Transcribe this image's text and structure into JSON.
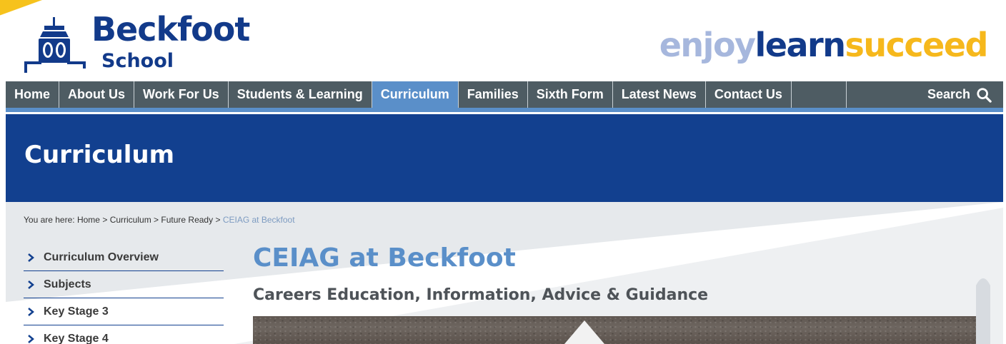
{
  "header": {
    "logo": {
      "name_line1": "Beckfoot",
      "name_line2": "School",
      "icon": "school-crest-icon"
    },
    "tagline": {
      "part1": "enjoy",
      "part2": "learn",
      "part3": "succeed",
      "colors": [
        "#a6b7dd",
        "#123a8a",
        "#f6b81c"
      ]
    }
  },
  "nav": {
    "items": [
      {
        "label": "Home"
      },
      {
        "label": "About Us"
      },
      {
        "label": "Work For Us"
      },
      {
        "label": "Students & Learning"
      },
      {
        "label": "Curriculum",
        "active": true
      },
      {
        "label": "Families"
      },
      {
        "label": "Sixth Form"
      },
      {
        "label": "Latest News"
      },
      {
        "label": "Contact Us"
      }
    ],
    "search_label": "Search",
    "search_icon": "search-icon"
  },
  "banner": {
    "title": "Curriculum"
  },
  "breadcrumb": {
    "prefix": "You are here:",
    "items": [
      "Home",
      "Curriculum",
      "Future Ready"
    ],
    "separator": ">",
    "current": "CEIAG at Beckfoot"
  },
  "sidebar": {
    "items": [
      {
        "label": "Curriculum Overview",
        "icon": "chevron-right-icon"
      },
      {
        "label": "Subjects",
        "icon": "chevron-right-icon"
      },
      {
        "label": "Key Stage 3",
        "icon": "chevron-right-icon"
      },
      {
        "label": "Key Stage 4",
        "icon": "chevron-right-icon"
      }
    ]
  },
  "main": {
    "title": "CEIAG at Beckfoot",
    "subtitle": "Careers Education, Information, Advice & Guidance"
  },
  "colors": {
    "brand_navy": "#12408f",
    "brand_light_blue": "#5a8fc9",
    "nav_gray": "#4e5c63",
    "brand_yellow": "#f6b81c"
  }
}
